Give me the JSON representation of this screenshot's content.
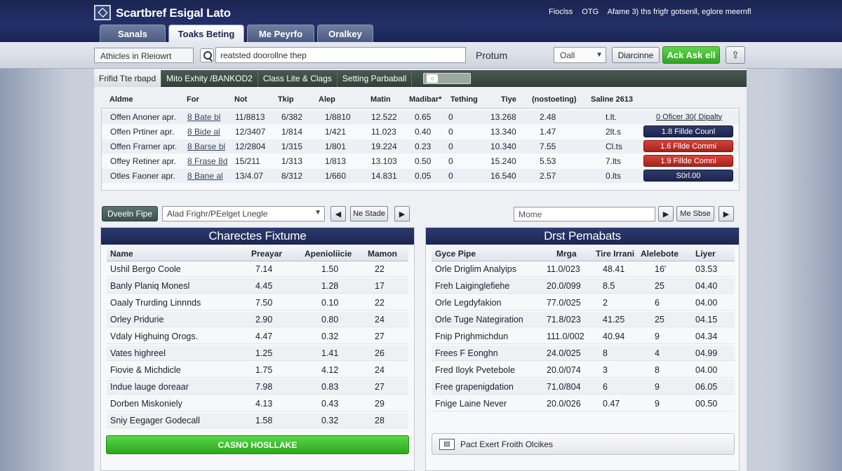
{
  "header": {
    "title": "Scartbref Esigal Lato",
    "right_items": [
      "Fioclss",
      "OTG",
      "Afame 3) ths frigfr gotsenll, eglore meernfl"
    ]
  },
  "tabs": [
    {
      "label": "Sanals",
      "active": false
    },
    {
      "label": "Toaks Beting",
      "active": true
    },
    {
      "label": "Me Peyrfo",
      "active": false
    },
    {
      "label": "Oralkey",
      "active": false
    }
  ],
  "search": {
    "left_select": "Athicles in Rleiowrt",
    "input_value": "reatsted doorollne thep",
    "label": "Protum",
    "dropdown": "Oall",
    "btn_dis": "Diarcinne",
    "btn_add": "Ack Ask ell"
  },
  "subtabs": [
    "Frifid Tte rbapd",
    "Mito Exhity /BANKOD2",
    "Class Lite & Clags",
    "Setting Parbaball"
  ],
  "top_table": {
    "headers": [
      "Aldme",
      "For",
      "Not",
      "Tkip",
      "Alep",
      "Matin",
      "Madibar*",
      "Tething",
      "Tiye",
      "(nostoeting)",
      "Saline 2613"
    ],
    "rows": [
      {
        "name": "Offen Anoner apr.",
        "link": "8 Bate bl",
        "c1": "11/8813",
        "c2": "6/382",
        "c3": "1/8810",
        "c4": "12.522",
        "c5": "0.65",
        "c6": "0",
        "c7": "13.268",
        "c8": "2.48",
        "c9": "t.lt.",
        "pill": "0 Oficer 30( Dipalty",
        "pill_style": "plain"
      },
      {
        "name": "Offen Prtiner apr.",
        "link": "8 Bide al",
        "c1": "12/3407",
        "c2": "1/814",
        "c3": "1/421",
        "c4": "11.023",
        "c5": "0.40",
        "c6": "0",
        "c7": "13.340",
        "c8": "1.47",
        "c9": "2lt.s",
        "pill": "1.8   Fillde Counl",
        "pill_style": "navy"
      },
      {
        "name": "Offen Frarner apr.",
        "link": "8 Barse bl",
        "c1": "12/2804",
        "c2": "1/315",
        "c3": "1/801",
        "c4": "19.224",
        "c5": "0.23",
        "c6": "0",
        "c7": "10.340",
        "c8": "7.55",
        "c9": "Cl.ts",
        "pill": "1.6   Fllde Commi",
        "pill_style": "red"
      },
      {
        "name": "Offey Retiner apr.",
        "link": "8 Frase 8d",
        "c1": "15/211",
        "c2": "1/313",
        "c3": "1/813",
        "c4": "13.103",
        "c5": "0.50",
        "c6": "0",
        "c7": "15.240",
        "c8": "5.53",
        "c9": "7.lts",
        "pill": "1.9   Fillde Comnl",
        "pill_style": "red"
      },
      {
        "name": "Otles Faoner apr.",
        "link": "8 Bane al",
        "c1": "13/4.07",
        "c2": "8/312",
        "c3": "1/660",
        "c4": "14.831",
        "c5": "0.05",
        "c6": "0",
        "c7": "16.540",
        "c8": "2.57",
        "c9": "0.lts",
        "pill": "S0rl.00",
        "pill_style": "navy"
      }
    ]
  },
  "controls": {
    "left_btn": "Dveeln Fipe",
    "select": "Alad Frighr/PEelget Lnegle",
    "btn_left_state": "Ne Stade",
    "input_right": "Mome",
    "btn_right_state": "Me Sbse"
  },
  "left_card": {
    "title": "Charectes Fixtume",
    "headers": [
      "Name",
      "Preayar",
      "Apenioliicie",
      "Mamon"
    ],
    "rows": [
      [
        "Ushil Bergo Coole",
        "7.14",
        "1.50",
        "22"
      ],
      [
        "Banly Planiq Monesl",
        "4.45",
        "1.28",
        "17"
      ],
      [
        "Oaaly Trurding Linnnds",
        "7.50",
        "0.10",
        "22"
      ],
      [
        "Orley Pridurie",
        "2.90",
        "0.80",
        "24"
      ],
      [
        "Vdaly Highuing Orogs.",
        "4.47",
        "0.32",
        "27"
      ],
      [
        "Vates highreel",
        "1.25",
        "1.41",
        "26"
      ],
      [
        "Fiovie & Michdicle",
        "1.75",
        "4.12",
        "24"
      ],
      [
        "Indue lauge doreaar",
        "7.98",
        "0.83",
        "27"
      ],
      [
        "Dorben Miskoniely",
        "4.13",
        "0.43",
        "29"
      ],
      [
        "Sniy Eegager Godecall",
        "1.58",
        "0.32",
        "28"
      ]
    ],
    "button": "CASNO HOSLLAKE"
  },
  "right_card": {
    "title": "Drst Pemabats",
    "headers": [
      "Gyce Pipe",
      "Mrga",
      "Tire Irrani",
      "Alelebote",
      "Liyer"
    ],
    "rows": [
      [
        "Orle Driglim Analyips",
        "11.0/023",
        "48.41",
        "16'",
        "03.53"
      ],
      [
        "Freh Laiginglefiehe",
        "20.0/099",
        "8.5",
        "25",
        "04.40"
      ],
      [
        "Orle Legdyfakion",
        "77.0/025",
        "2",
        "6",
        "04.00"
      ],
      [
        "Orle Tuge Nategiration",
        "71.8/023",
        "41.25",
        "25",
        "04.15"
      ],
      [
        "Fnip Prighmichdun",
        "111.0/002",
        "40.94",
        "9",
        "04.34"
      ],
      [
        "Frees F Eonghn",
        "24.0/025",
        "8",
        "4",
        "04.99"
      ],
      [
        "Fred Iloyk Pvetebole",
        "20.0/074",
        "3",
        "8",
        "04.00"
      ],
      [
        "Free grapenigdation",
        "71.0/804",
        "6",
        "9",
        "06.05"
      ],
      [
        "Fnige Laine Never",
        "20.0/026",
        "0.47",
        "9",
        "00.50"
      ]
    ],
    "button": "Pact Exert Froith Olcikes"
  }
}
